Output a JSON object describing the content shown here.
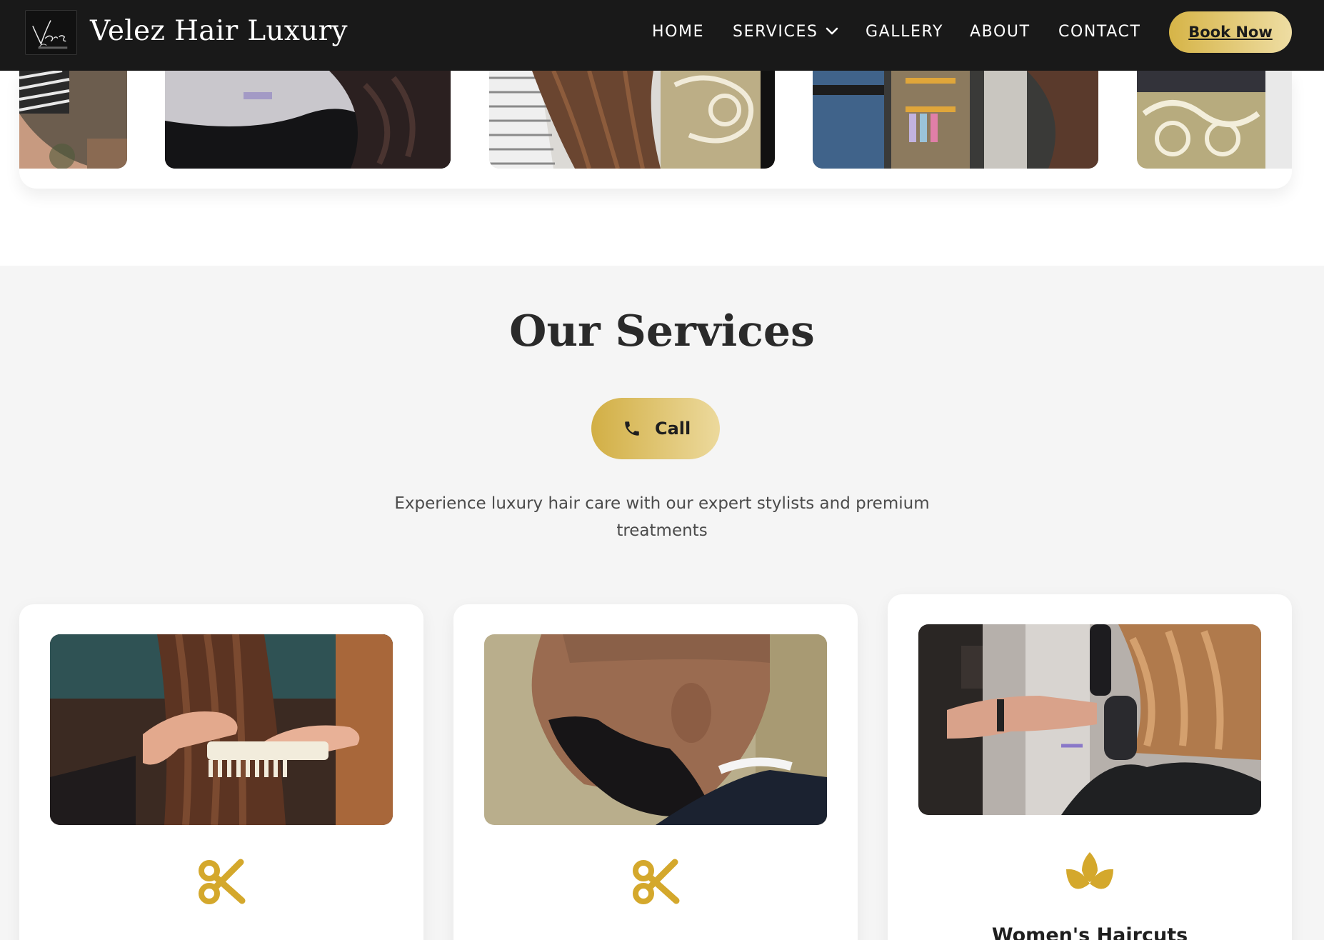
{
  "brand": {
    "name": "Velez Hair Luxury",
    "logo_text": "Velez",
    "logo_subtext": "HAIR LUXURY"
  },
  "nav": {
    "home": "HOME",
    "services": "SERVICES",
    "gallery": "GALLERY",
    "about": "ABOUT",
    "contact": "CONTACT",
    "book_now": "Book Now"
  },
  "gallery": {
    "photos": [
      "salon-photo",
      "salon-photo",
      "salon-photo",
      "salon-photo",
      "salon-photo"
    ]
  },
  "services_section": {
    "title": "Our Services",
    "call_label": "Call",
    "description": "Experience luxury hair care with our expert stylists and premium treatments",
    "cards": [
      {
        "icon": "scissors-icon",
        "image": "hair-comb-photo"
      },
      {
        "icon": "scissors-icon",
        "image": "beard-trim-photo"
      },
      {
        "icon": "lotus-icon",
        "image": "blow-dry-photo",
        "name": "Women's Haircuts"
      }
    ]
  },
  "colors": {
    "nav_bg": "#191919",
    "gold": "#d4a82c",
    "gold_light": "#eedda3",
    "section_bg": "#f5f5f5",
    "card_bg": "#ffffff"
  }
}
